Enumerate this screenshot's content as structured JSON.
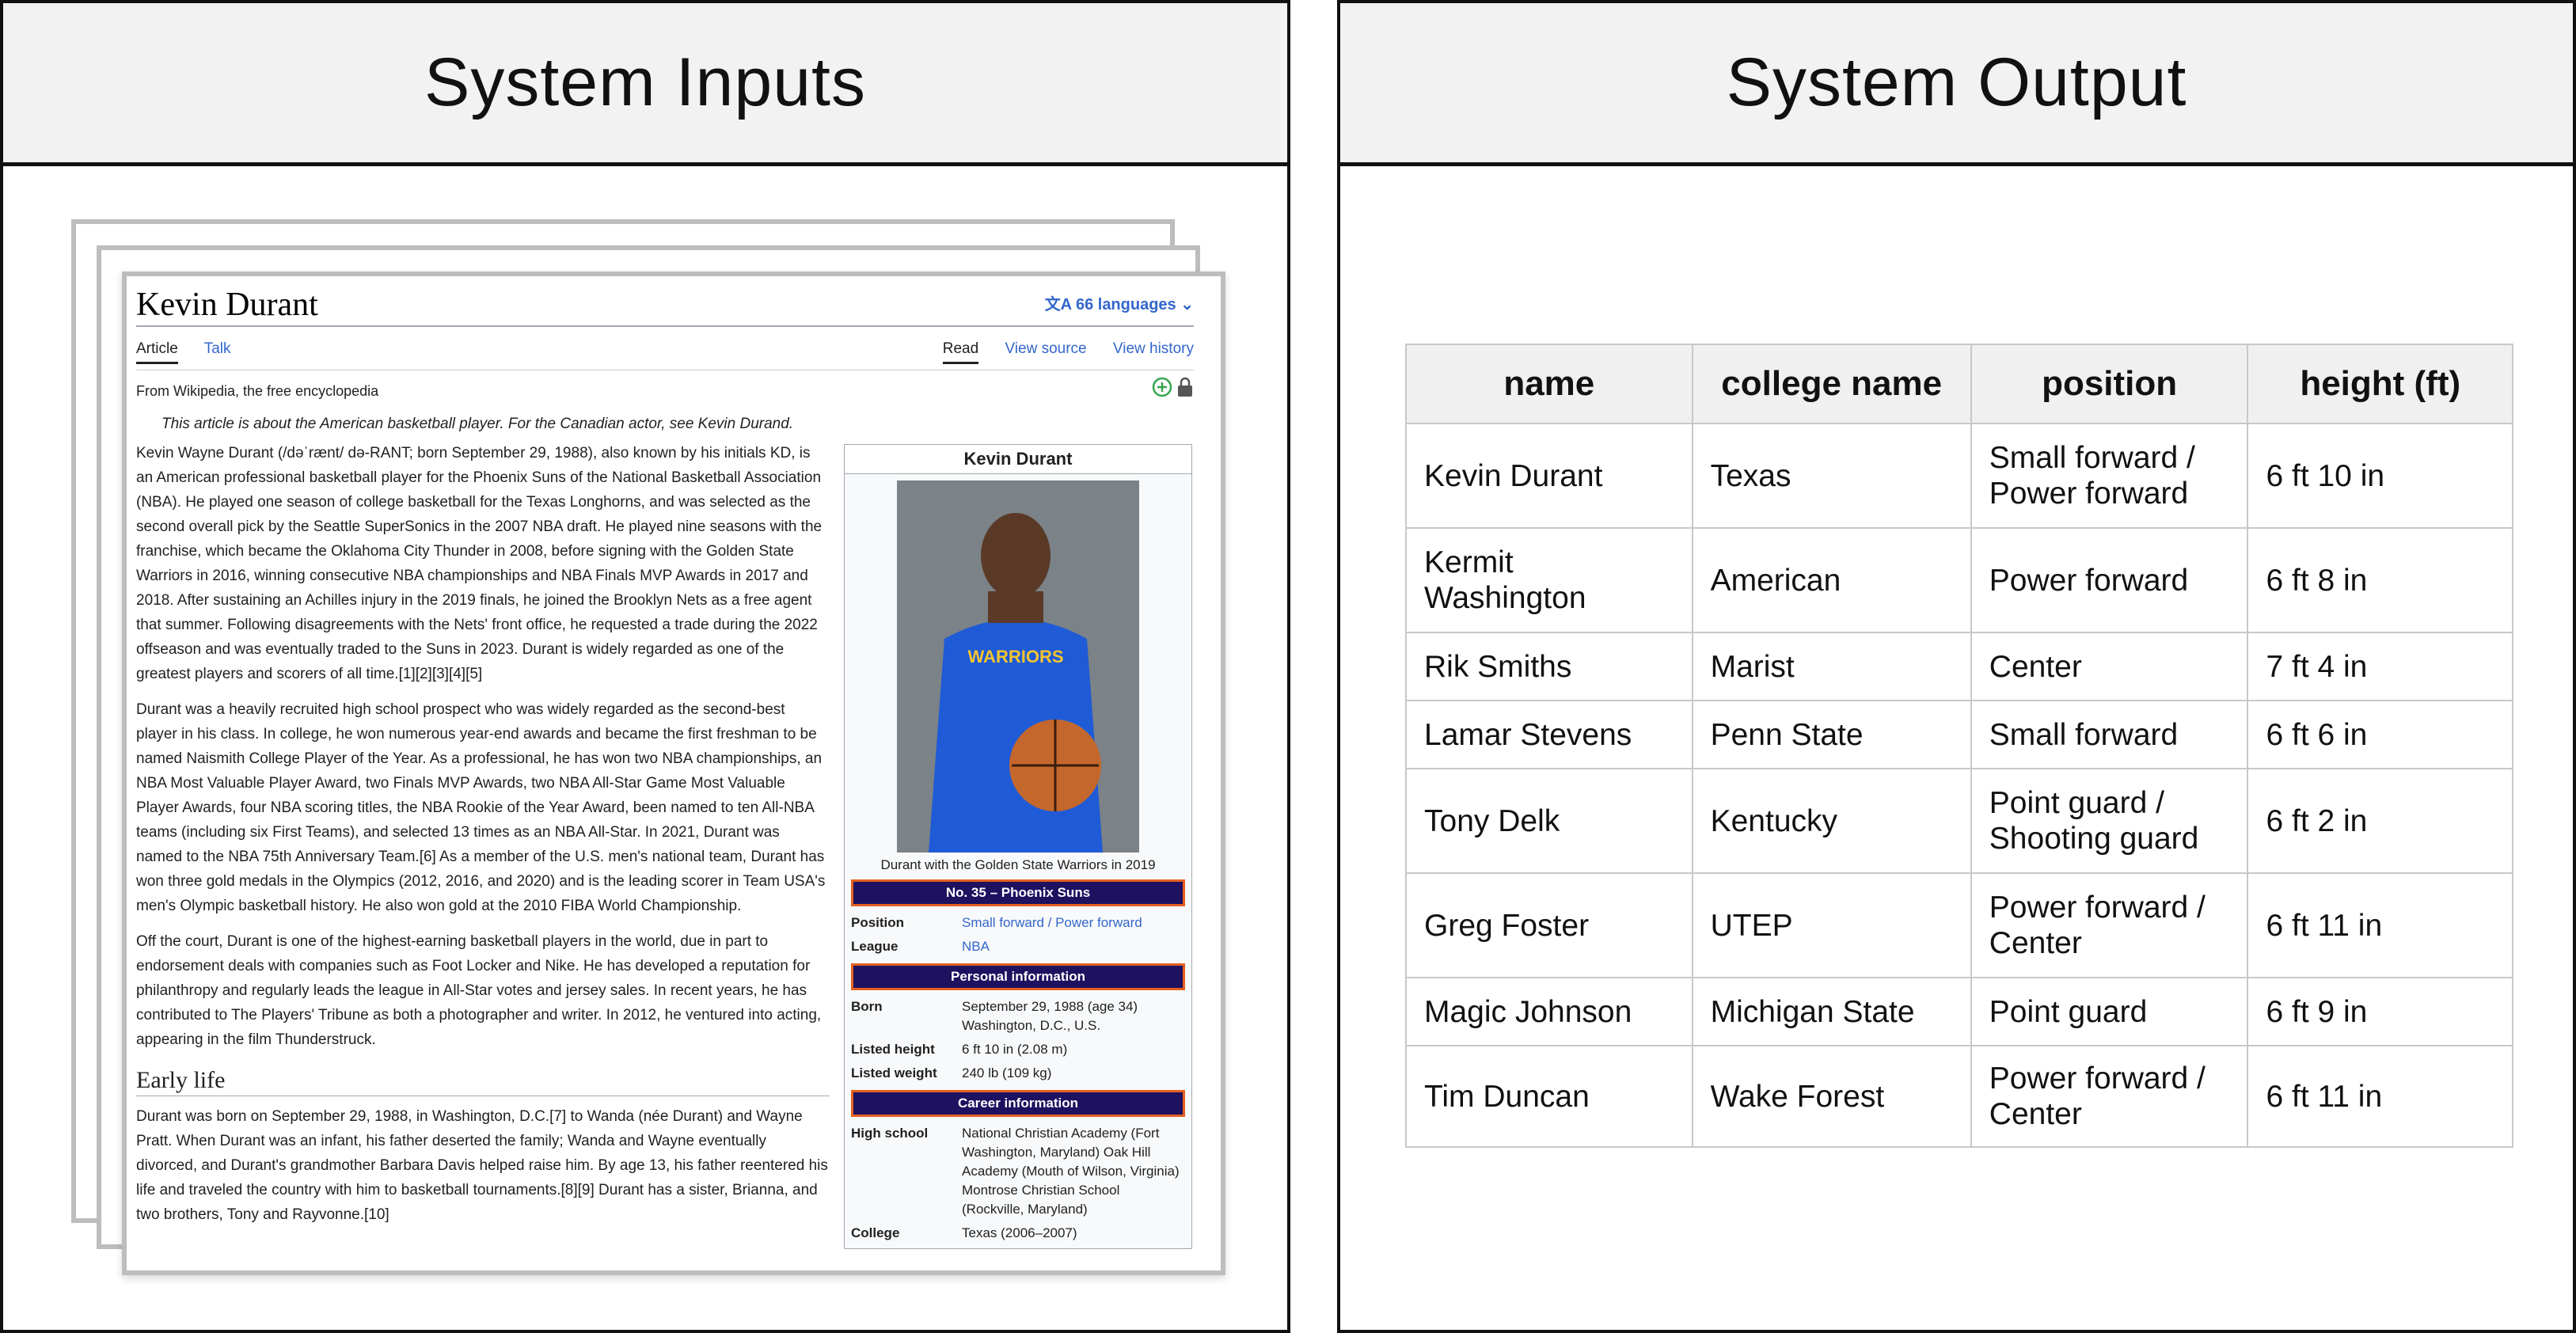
{
  "left_panel": {
    "title": "System Inputs"
  },
  "right_panel": {
    "title": "System Output"
  },
  "wiki": {
    "title": "Kevin Durant",
    "languages": "66 languages",
    "tabs_left": [
      "Article",
      "Talk"
    ],
    "tabs_right": [
      "Read",
      "View source",
      "View history"
    ],
    "from": "From Wikipedia, the free encyclopedia",
    "hatnote": "This article is about the American basketball player. For the Canadian actor, see Kevin Durand.",
    "paragraphs": [
      "Kevin Wayne Durant (/dəˈrænt/ də-RANT; born September 29, 1988), also known by his initials KD, is an American professional basketball player for the Phoenix Suns of the National Basketball Association (NBA). He played one season of college basketball for the Texas Longhorns, and was selected as the second overall pick by the Seattle SuperSonics in the 2007 NBA draft. He played nine seasons with the franchise, which became the Oklahoma City Thunder in 2008, before signing with the Golden State Warriors in 2016, winning consecutive NBA championships and NBA Finals MVP Awards in 2017 and 2018. After sustaining an Achilles injury in the 2019 finals, he joined the Brooklyn Nets as a free agent that summer. Following disagreements with the Nets' front office, he requested a trade during the 2022 offseason and was eventually traded to the Suns in 2023. Durant is widely regarded as one of the greatest players and scorers of all time.[1][2][3][4][5]",
      "Durant was a heavily recruited high school prospect who was widely regarded as the second-best player in his class. In college, he won numerous year-end awards and became the first freshman to be named Naismith College Player of the Year. As a professional, he has won two NBA championships, an NBA Most Valuable Player Award, two Finals MVP Awards, two NBA All-Star Game Most Valuable Player Awards, four NBA scoring titles, the NBA Rookie of the Year Award, been named to ten All-NBA teams (including six First Teams), and selected 13 times as an NBA All-Star. In 2021, Durant was named to the NBA 75th Anniversary Team.[6] As a member of the U.S. men's national team, Durant has won three gold medals in the Olympics (2012, 2016, and 2020) and is the leading scorer in Team USA's men's Olympic basketball history. He also won gold at the 2010 FIBA World Championship.",
      "Off the court, Durant is one of the highest-earning basketball players in the world, due in part to endorsement deals with companies such as Foot Locker and Nike. He has developed a reputation for philanthropy and regularly leads the league in All-Star votes and jersey sales. In recent years, he has contributed to The Players' Tribune as both a photographer and writer. In 2012, he ventured into acting, appearing in the film Thunderstruck."
    ],
    "section_heading": "Early life",
    "early_life": "Durant was born on September 29, 1988, in Washington, D.C.[7] to Wanda (née Durant) and Wayne Pratt. When Durant was an infant, his father deserted the family; Wanda and Wayne eventually divorced, and Durant's grandmother Barbara Davis helped raise him. By age 13, his father reentered his life and traveled the country with him to basketball tournaments.[8][9] Durant has a sister, Brianna, and two brothers, Tony and Rayvonne.[10]",
    "infobox": {
      "title": "Kevin Durant",
      "caption": "Durant with the Golden State Warriors in 2019",
      "bar1": "No. 35 – Phoenix Suns",
      "position_k": "Position",
      "position_v": "Small forward / Power forward",
      "league_k": "League",
      "league_v": "NBA",
      "bar2": "Personal information",
      "born_k": "Born",
      "born_v": "September 29, 1988 (age 34) Washington, D.C., U.S.",
      "height_k": "Listed height",
      "height_v": "6 ft 10 in (2.08 m)",
      "weight_k": "Listed weight",
      "weight_v": "240 lb (109 kg)",
      "bar3": "Career information",
      "hs_k": "High school",
      "hs_v": "National Christian Academy (Fort Washington, Maryland) Oak Hill Academy (Mouth of Wilson, Virginia) Montrose Christian School (Rockville, Maryland)",
      "college_k": "College",
      "college_v": "Texas (2006–2007)"
    }
  },
  "table": {
    "headers": [
      "name",
      "college name",
      "position",
      "height (ft)"
    ],
    "rows": [
      [
        "Kevin Durant",
        "Texas",
        "Small forward / Power forward",
        "6 ft 10 in"
      ],
      [
        "Kermit Washington",
        "American",
        "Power forward",
        "6 ft 8 in"
      ],
      [
        "Rik Smiths",
        "Marist",
        "Center",
        "7 ft 4 in"
      ],
      [
        "Lamar Stevens",
        "Penn State",
        "Small forward",
        "6 ft 6 in"
      ],
      [
        "Tony Delk",
        "Kentucky",
        "Point guard / Shooting guard",
        "6 ft 2 in"
      ],
      [
        "Greg Foster",
        "UTEP",
        "Power forward / Center",
        "6 ft 11 in"
      ],
      [
        "Magic Johnson",
        "Michigan State",
        "Point guard",
        "6 ft 9 in"
      ],
      [
        "Tim Duncan",
        "Wake Forest",
        "Power forward / Center",
        "6 ft 11 in"
      ]
    ]
  }
}
